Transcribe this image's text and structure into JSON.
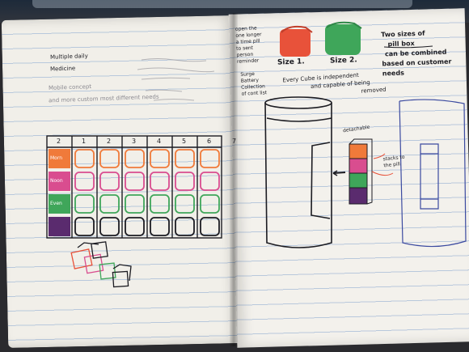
{
  "photo": {
    "colors": {
      "paper": "#f2f0eb",
      "rule_line": "#b8c8dc",
      "ink": "#1c1c22",
      "orange": "#f07a3a",
      "red": "#e8523a",
      "pink": "#d94d8f",
      "green": "#3fa65a",
      "purple": "#5a2b6e",
      "blue_pen": "#3b4aa0"
    }
  },
  "left_page": {
    "notes": {
      "line1": "Multiple daily",
      "line2": "Medicine",
      "line3": "Mobile concept",
      "line4": "and more custom  most different needs"
    },
    "grid": {
      "day_numbers": [
        "2",
        "1",
        "2",
        "3",
        "4",
        "5",
        "6",
        "7"
      ],
      "row_labels": [
        "Morn",
        "Noon",
        "Even",
        ""
      ],
      "row_colors": [
        "#f07a3a",
        "#d94d8f",
        "#3fa65a",
        "#5a2b6e"
      ]
    }
  },
  "right_page": {
    "open_note": {
      "line1": "open the",
      "line2": "one longer",
      "line3": "a time pill",
      "line4": "to sent",
      "line5": "person",
      "line6": "reminder"
    },
    "size1_label": "Size 1.",
    "size2_label": "Size 2.",
    "two_sizes_note": {
      "line1": "Two sizes of",
      "line2": "pill box",
      "line3": "can be combined",
      "line4": "based on customer",
      "line5": "needs"
    },
    "cube_note": {
      "line1": "Every Cube is independent",
      "line2": "and capable of being",
      "line3": "removed"
    },
    "side_note": {
      "line1": "Surge",
      "line2": "Battery",
      "line3": "Collection",
      "line4": "of cont list"
    },
    "detach_label": "detachable",
    "stack_label": "stacks to the pill"
  }
}
